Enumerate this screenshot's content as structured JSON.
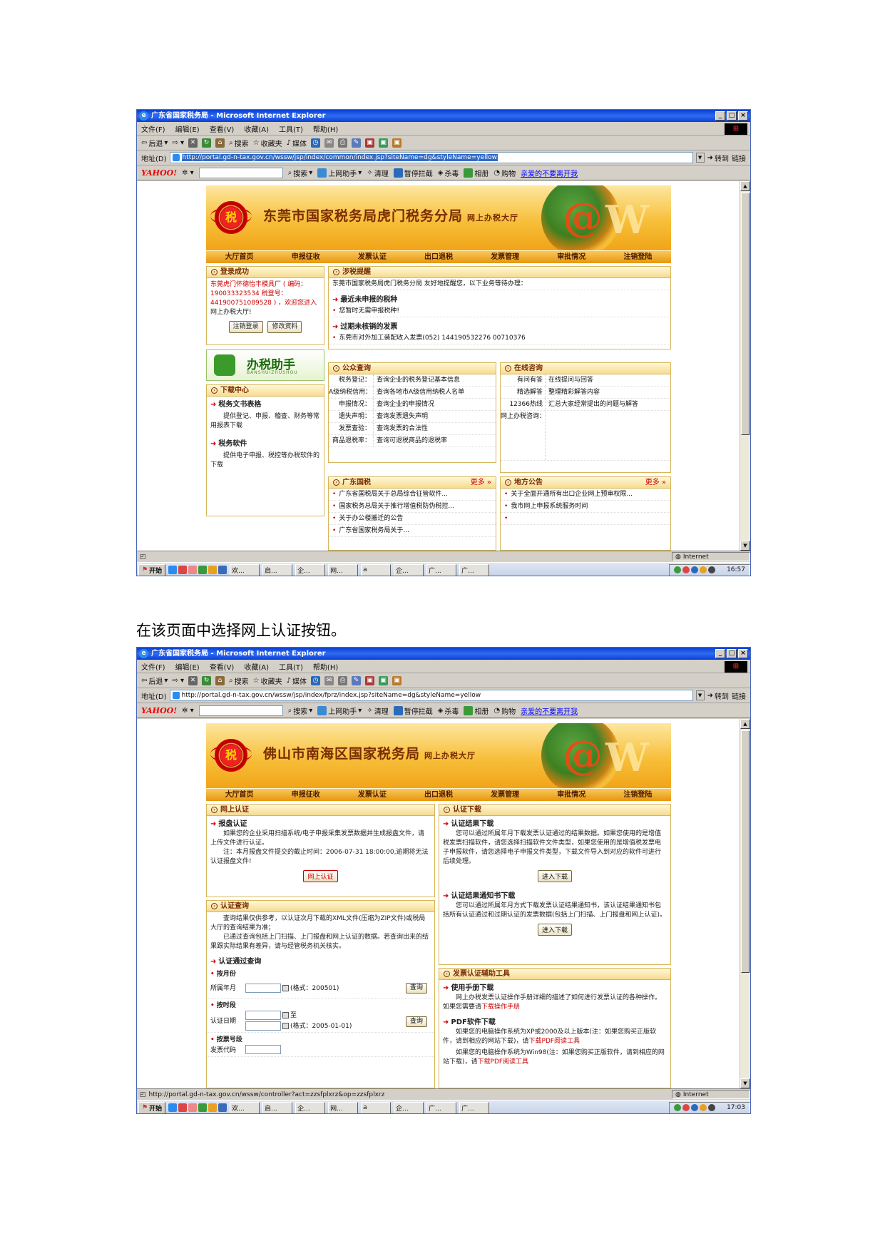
{
  "caption": "在该页面中选择网上认证按钮。",
  "browser": {
    "title": "广东省国家税务局 - Microsoft Internet Explorer",
    "menu": [
      "文件(F)",
      "编辑(E)",
      "查看(V)",
      "收藏(A)",
      "工具(T)",
      "帮助(H)"
    ],
    "toolbar": {
      "back": "后退",
      "search": "搜索",
      "favorites": "收藏夹",
      "media": "媒体"
    },
    "address_label": "地址(D)",
    "go": "转到",
    "links": "链接",
    "yahoo": {
      "logo": "YAHOO!",
      "search": "搜索",
      "items": [
        "上网助手",
        "清理",
        "暂停拦截",
        "杀毒",
        "相册",
        "购物"
      ],
      "link": "亲爱的不要离开我"
    },
    "start": "开始",
    "zone": "Internet",
    "tasks": [
      "欢...",
      "启...",
      "企...",
      "网...",
      "a",
      "企...",
      "广...",
      "广..."
    ]
  },
  "nav": [
    "大厅首页",
    "申报征收",
    "发票认证",
    "出口退税",
    "发票管理",
    "审批情况",
    "注销登陆"
  ],
  "shot1": {
    "address": "http://portal.gd-n-tax.gov.cn/wssw/jsp/index/common/index.jsp?siteName=dg&styleName=yellow",
    "clock": "16:57",
    "bureau": "东莞市国家税务局虎门税务分局",
    "subtitle": "网上办税大厅",
    "login": {
      "title": "登录成功",
      "line1": "东莞虎门怀德怡丰模具厂 ( 编码：",
      "line2": "190033323534 税登号：",
      "line3": "441900751089528 ) ，欢迎您进入",
      "line4": "网上办税大厅!",
      "logout": "注销登录",
      "edit": "修改资料"
    },
    "helper": {
      "name": "办税助手",
      "pinyin": "BANSHUIZHUSHOU"
    },
    "download": {
      "title": "下载中心",
      "s1": "税务文书表格",
      "t1": "提供登记、申报、稽查、财务等常用报表下载",
      "s2": "税务软件",
      "t2": "提供电子申报、税控等办税软件的下载"
    },
    "reminder": {
      "title": "涉税提醒",
      "greeting": "东莞市国家税务局虎门税务分局 友好地提醒您，以下业务等待办理：",
      "s1": "最近未申报的税种",
      "i1": "您暂时无需申报税种!",
      "s2": "过期未核销的发票",
      "i2": "东莞市对外加工装配收入发票(052) 144190532276 00710376"
    },
    "query": {
      "title": "公众查询",
      "rows": [
        {
          "k": "税务登记：",
          "v": "查询企业的税务登记基本信息"
        },
        {
          "k": "A级纳税信用：",
          "v": "查询各地市A级信用纳税人名单"
        },
        {
          "k": "申报情况：",
          "v": "查询企业的申报情况"
        },
        {
          "k": "遗失声明：",
          "v": "查询发票遗失声明"
        },
        {
          "k": "发票查验：",
          "v": "查询发票的合法性"
        },
        {
          "k": "商品退税率：",
          "v": "查询可退税商品的退税率"
        }
      ]
    },
    "consult": {
      "title": "在线咨询",
      "rows": [
        {
          "k": "有问有答",
          "v": "在线提问与回答"
        },
        {
          "k": "精选解答",
          "v": "整理精彩解答内容"
        },
        {
          "k": "12366热线",
          "v": "汇总大家经常提出的问题与解答"
        },
        {
          "k": "网上办税咨询：",
          "v": ""
        }
      ]
    },
    "gdtax": {
      "title": "广东国税",
      "more": "更多",
      "items": [
        "广东省国税局关于总局综合征管软件...",
        "国家税务总局关于推行增值税防伪税控...",
        "关于办公楼搬迁的公告",
        "广东省国家税务局关于..."
      ]
    },
    "notice": {
      "title": "地方公告",
      "more": "更多",
      "items": [
        "关于全面开通所有出口企业网上预审权限...",
        "我市网上申报系统服务时间",
        ""
      ]
    }
  },
  "shot2": {
    "address": "http://portal.gd-n-tax.gov.cn/wssw/jsp/index/fprz/index.jsp?siteName=dg&styleName=yellow",
    "status": "http://portal.gd-n-tax.gov.cn/wssw/controller?act=zzsfplxrz&op=zzsfplxrz",
    "clock": "17:03",
    "bureau": "佛山市南海区国家税务局",
    "subtitle": "网上办税大厅",
    "online_cert": {
      "title": "网上认证",
      "sec": "报盘认证",
      "text1": "如果您的企业采用扫描系统/电子申报采集发票数据并生成报盘文件，请上传文件进行认证。",
      "text2": "注：本月报盘文件提交的截止时间：2006-07-31 18:00:00,逾期将无法认证报盘文件!",
      "button": "网上认证"
    },
    "cert_query": {
      "title": "认证查询",
      "text1": "查询结果仅供参考，以认证次月下载的XML文件(压缩为ZIP文件)或税局大厅的查询结果为准；",
      "text2": "已通过查询包括上门扫描、上门报盘和网上认证的数据。若查询出来的结果跟实际结果有差异，请与经管税务机关核实。",
      "sec": "认证通过查询",
      "by_month": "按月份",
      "month_label": "所属年月",
      "month_fmt": "(格式：200501)",
      "query": "查询",
      "by_period": "按时段",
      "date_label": "认证日期",
      "to": "至",
      "date_fmt": "(格式：2005-01-01)",
      "by_number": "按票号段",
      "code_label": "发票代码"
    },
    "cert_download": {
      "title": "认证下载",
      "s1": "认证结果下载",
      "t1": "您可以通过所属年月下载发票认证通过的结果数据。如果您使用的是增值税发票扫描软件，请您选择扫描软件文件类型，如果您使用的是增值税发票电子申报软件，请您选择电子申报文件类型，下载文件导入到对应的软件可进行后续处理。",
      "b1": "进入下载",
      "s2": "认证结果通知书下载",
      "t2": "您可以通过所属年月方式下载发票认证结果通知书，该认证结果通知书包括所有认证通过和过期认证的发票数据(包括上门扫描、上门报盘和网上认证)。",
      "b2": "进入下载"
    },
    "tools": {
      "title": "发票认证辅助工具",
      "s1": "使用手册下载",
      "t1a": "网上办税发票认证操作手册详细的描述了如何进行发票认证的各种操作。如果您需要请",
      "t1b": "下载操作手册",
      "s2": "PDF软件下载",
      "t2a": "如果您的电脑操作系统为XP或2000及以上版本(注：如果您购买正版软件，请到相应的网站下载)，请",
      "t2b": "下载PDF阅读工具",
      "t3a": "如果您的电脑操作系统为Win98(注：如果您购买正版软件，请到相应的网站下载)，请",
      "t3b": "下载PDF阅读工具"
    }
  }
}
